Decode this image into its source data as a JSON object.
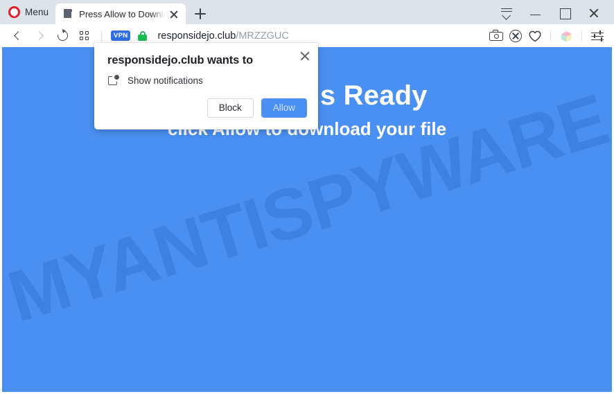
{
  "browser": {
    "menu_label": "Menu",
    "logo_icon": "opera-logo-icon",
    "tab": {
      "title": "Press Allow to Download",
      "favicon": "page-document-icon",
      "close_icon": "close-icon"
    },
    "new_tab_icon": "plus-icon",
    "window_controls": {
      "tab_menu_icon": "tab-list-chevron-down-icon",
      "minimize_icon": "minimize-icon",
      "maximize_icon": "maximize-icon",
      "close_icon": "close-icon"
    },
    "toolbar": {
      "back_icon": "chevron-left-icon",
      "forward_icon": "chevron-right-icon",
      "reload_icon": "reload-icon",
      "speeddial_icon": "grid-squares-icon",
      "vpn_badge": "VPN",
      "lock_icon": "padlock-secure-icon",
      "url_host": "responsidejo.club",
      "url_path": "/MRZZGUC",
      "right_icons": [
        "camera-snapshot-icon",
        "adblocker-shield-icon",
        "heart-favorites-icon",
        "cube-extensions-icon",
        "easy-setup-sliders-icon"
      ]
    }
  },
  "page": {
    "headline": "Your File Is Ready",
    "subline": "click Allow to download your file",
    "watermark": "MYANTISPYWARE.COM",
    "background_color": "#4a90f2"
  },
  "permission_dialog": {
    "title": "responsidejo.club wants to",
    "permission_icon": "notifications-icon",
    "permission_label": "Show notifications",
    "block_label": "Block",
    "allow_label": "Allow",
    "close_icon": "close-icon",
    "allow_color": "#4a90f2"
  }
}
